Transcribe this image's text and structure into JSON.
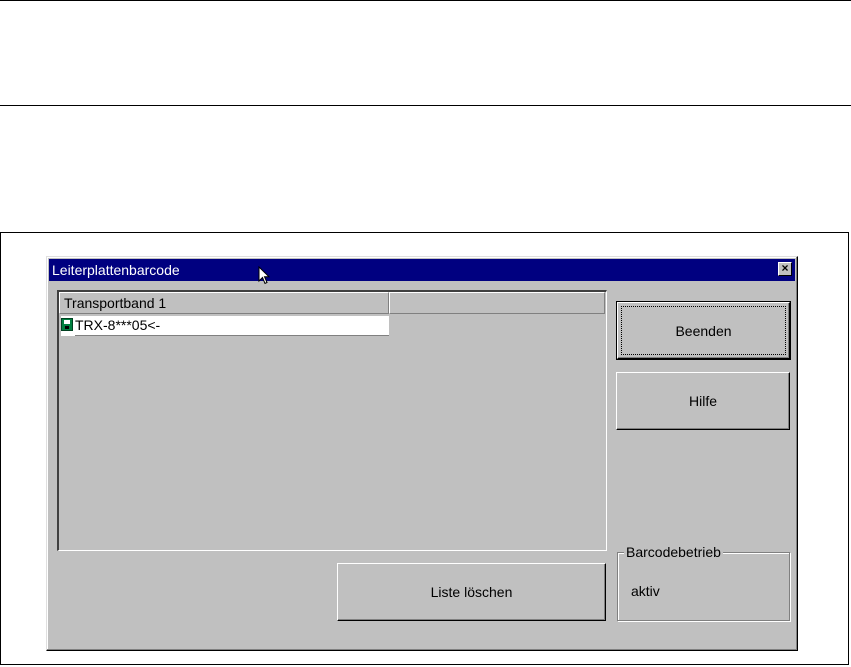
{
  "window": {
    "title": "Leiterplattenbarcode",
    "close_glyph": "×"
  },
  "list": {
    "columns": [
      "Transportband 1",
      ""
    ],
    "rows": [
      {
        "icon": "disk-icon",
        "text": "TRX-8***05<-"
      }
    ]
  },
  "buttons": {
    "quit_label": "Beenden",
    "help_label": "Hilfe",
    "clear_label": "Liste löschen"
  },
  "status_group": {
    "legend": "Barcodebetrieb",
    "value": "aktiv"
  },
  "colors": {
    "titlebar": "#000080",
    "face": "#c0c0c0"
  }
}
